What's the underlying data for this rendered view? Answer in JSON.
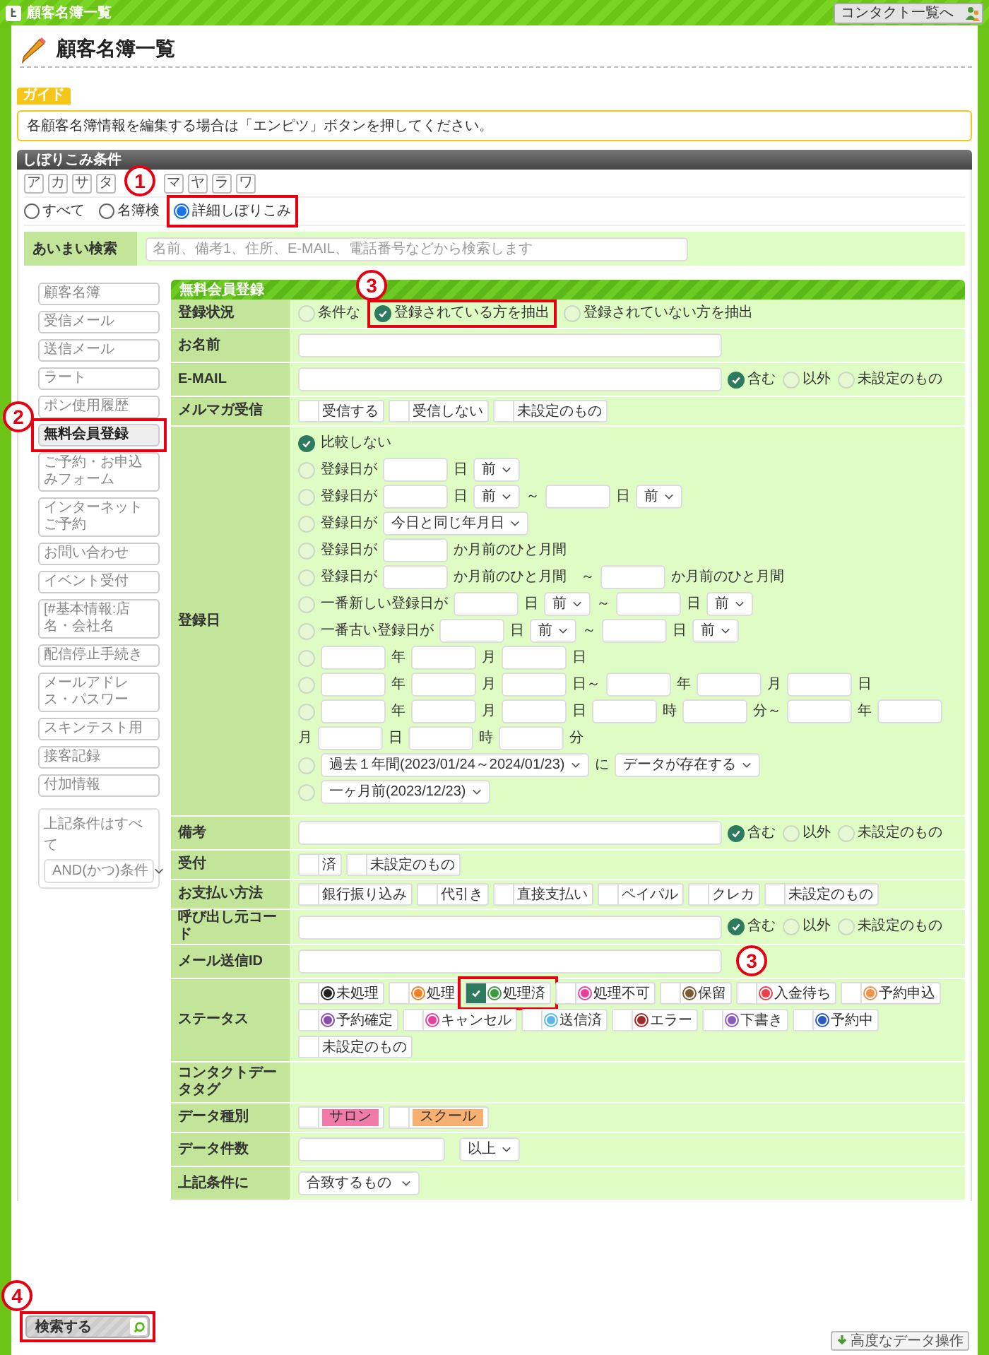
{
  "window": {
    "title": "顧客名簿一覧",
    "nav_button": "コンタクト一覧へ"
  },
  "heading": "顧客名簿一覧",
  "guide": {
    "tag": "ガイド",
    "text": "各顧客名簿情報を編集する場合は「エンピツ」ボタンを押してください。"
  },
  "filter_panel": {
    "title": "しぼりこみ条件",
    "kana": [
      "ア",
      "カ",
      "サ",
      "タ",
      "マ",
      "ヤ",
      "ラ",
      "ワ"
    ],
    "modes": [
      {
        "label": "すべて",
        "selected": false
      },
      {
        "label": "名簿検",
        "selected": false
      },
      {
        "label": "詳細しぼりこみ",
        "selected": true
      }
    ],
    "fuzzy_search": {
      "label": "あいまい検索",
      "placeholder": "名前、備考1、住所、E-MAIL、電話番号などから検索します"
    }
  },
  "sidebar": {
    "items": [
      {
        "label": "顧客名簿",
        "selected": false
      },
      {
        "label": "受信メール",
        "selected": false
      },
      {
        "label": "送信メール",
        "selected": false
      },
      {
        "label": "ラート",
        "selected": false
      },
      {
        "label": "ポン使用履歴",
        "selected": false
      },
      {
        "label": "無料会員登録",
        "selected": true
      },
      {
        "label": "ご予約・お申込みフォーム",
        "selected": false
      },
      {
        "label": "インターネットご予約",
        "selected": false
      },
      {
        "label": "お問い合わせ",
        "selected": false
      },
      {
        "label": "イベント受付",
        "selected": false
      },
      {
        "label": "[#基本情報:店名・会社名",
        "selected": false
      },
      {
        "label": "配信停止手続き",
        "selected": false
      },
      {
        "label": "メールアドレス・パスワー",
        "selected": false
      },
      {
        "label": "スキンテスト用",
        "selected": false
      },
      {
        "label": "接客記録",
        "selected": false
      },
      {
        "label": "付加情報",
        "selected": false
      }
    ],
    "combine": {
      "label": "上記条件はすべて",
      "value": "AND(かつ)条件"
    }
  },
  "form": {
    "title": "無料会員登録",
    "rows": [
      {
        "kind": "radios",
        "label": "登録状況",
        "options": [
          {
            "label": "条件な",
            "selected": false
          },
          {
            "label": "登録されている方を抽出",
            "selected": true
          },
          {
            "label": "登録されていない方を抽出",
            "selected": false
          }
        ]
      },
      {
        "kind": "text",
        "label": "お名前"
      },
      {
        "kind": "text_match",
        "label": "E-MAIL",
        "options": [
          {
            "label": "含む",
            "selected": true
          },
          {
            "label": "以外",
            "selected": false
          },
          {
            "label": "未設定のもの",
            "selected": false
          }
        ]
      },
      {
        "kind": "checks",
        "label": "メルマガ受信",
        "options": [
          {
            "label": "受信する",
            "checked": false
          },
          {
            "label": "受信しない",
            "checked": false
          },
          {
            "label": "未設定のもの",
            "checked": false
          }
        ]
      },
      {
        "kind": "dates",
        "label": "登録日",
        "lines": [
          {
            "selected": true,
            "parts": [
              {
                "kind": "text",
                "text": "比較しない"
              }
            ]
          },
          {
            "selected": false,
            "parts": [
              {
                "kind": "text",
                "text": "登録日が"
              },
              {
                "kind": "input"
              },
              {
                "kind": "text",
                "text": "日"
              },
              {
                "kind": "select",
                "value": "前"
              }
            ]
          },
          {
            "selected": false,
            "parts": [
              {
                "kind": "text",
                "text": "登録日が"
              },
              {
                "kind": "input"
              },
              {
                "kind": "text",
                "text": "日"
              },
              {
                "kind": "select",
                "value": "前"
              },
              {
                "kind": "text",
                "text": "～"
              },
              {
                "kind": "input"
              },
              {
                "kind": "text",
                "text": "日"
              },
              {
                "kind": "select",
                "value": "前"
              }
            ]
          },
          {
            "selected": false,
            "parts": [
              {
                "kind": "text",
                "text": "登録日が"
              },
              {
                "kind": "select",
                "value": "今日と同じ年月日"
              }
            ]
          },
          {
            "selected": false,
            "parts": [
              {
                "kind": "text",
                "text": "登録日が"
              },
              {
                "kind": "input"
              },
              {
                "kind": "text",
                "text": "か月前のひと月間"
              }
            ]
          },
          {
            "selected": false,
            "parts": [
              {
                "kind": "text",
                "text": "登録日が"
              },
              {
                "kind": "input"
              },
              {
                "kind": "text",
                "text": "か月前のひと月間　～"
              },
              {
                "kind": "input"
              },
              {
                "kind": "text",
                "text": "か月前のひと月間"
              }
            ]
          },
          {
            "selected": false,
            "parts": [
              {
                "kind": "text",
                "text": "一番新しい登録日が"
              },
              {
                "kind": "input"
              },
              {
                "kind": "text",
                "text": "日"
              },
              {
                "kind": "select",
                "value": "前"
              },
              {
                "kind": "text",
                "text": "～"
              },
              {
                "kind": "input"
              },
              {
                "kind": "text",
                "text": "日"
              },
              {
                "kind": "select",
                "value": "前"
              }
            ]
          },
          {
            "selected": false,
            "parts": [
              {
                "kind": "text",
                "text": "一番古い登録日が"
              },
              {
                "kind": "input"
              },
              {
                "kind": "text",
                "text": "日"
              },
              {
                "kind": "select",
                "value": "前"
              },
              {
                "kind": "text",
                "text": "～"
              },
              {
                "kind": "input"
              },
              {
                "kind": "text",
                "text": "日"
              },
              {
                "kind": "select",
                "value": "前"
              }
            ]
          },
          {
            "selected": false,
            "parts": [
              {
                "kind": "input"
              },
              {
                "kind": "text",
                "text": "年"
              },
              {
                "kind": "input"
              },
              {
                "kind": "text",
                "text": "月"
              },
              {
                "kind": "input"
              },
              {
                "kind": "text",
                "text": "日"
              }
            ]
          },
          {
            "selected": false,
            "parts": [
              {
                "kind": "input"
              },
              {
                "kind": "text",
                "text": "年"
              },
              {
                "kind": "input"
              },
              {
                "kind": "text",
                "text": "月"
              },
              {
                "kind": "input"
              },
              {
                "kind": "text",
                "text": "日～"
              },
              {
                "kind": "input"
              },
              {
                "kind": "text",
                "text": "年"
              },
              {
                "kind": "input"
              },
              {
                "kind": "text",
                "text": "月"
              },
              {
                "kind": "input"
              },
              {
                "kind": "text",
                "text": "日"
              }
            ]
          },
          {
            "selected": false,
            "parts": [
              {
                "kind": "input"
              },
              {
                "kind": "text",
                "text": "年"
              },
              {
                "kind": "input"
              },
              {
                "kind": "text",
                "text": "月"
              },
              {
                "kind": "input"
              },
              {
                "kind": "text",
                "text": "日"
              },
              {
                "kind": "input"
              },
              {
                "kind": "text",
                "text": "時"
              },
              {
                "kind": "input"
              },
              {
                "kind": "text",
                "text": "分～"
              },
              {
                "kind": "input"
              },
              {
                "kind": "text",
                "text": "年"
              },
              {
                "kind": "input"
              },
              {
                "kind": "text",
                "text": "月"
              },
              {
                "kind": "input"
              },
              {
                "kind": "text",
                "text": "日"
              },
              {
                "kind": "input"
              },
              {
                "kind": "text",
                "text": "時"
              },
              {
                "kind": "input"
              },
              {
                "kind": "text",
                "text": "分"
              }
            ]
          },
          {
            "selected": false,
            "parts": [
              {
                "kind": "select",
                "value": "過去１年間(2023/01/24～2024/01/23)"
              },
              {
                "kind": "text",
                "text": "に"
              },
              {
                "kind": "select",
                "value": "データが存在する"
              }
            ]
          },
          {
            "selected": false,
            "parts": [
              {
                "kind": "select",
                "value": "一ヶ月前(2023/12/23)"
              }
            ]
          }
        ]
      },
      {
        "kind": "text_match",
        "label": "備考",
        "options": [
          {
            "label": "含む",
            "selected": true
          },
          {
            "label": "以外",
            "selected": false
          },
          {
            "label": "未設定のもの",
            "selected": false
          }
        ]
      },
      {
        "kind": "checks",
        "label": "受付",
        "options": [
          {
            "label": "済",
            "checked": false
          },
          {
            "label": "未設定のもの",
            "checked": false
          }
        ]
      },
      {
        "kind": "checks",
        "label": "お支払い方法",
        "options": [
          {
            "label": "銀行振り込み",
            "checked": false
          },
          {
            "label": "代引き",
            "checked": false
          },
          {
            "label": "直接支払い",
            "checked": false
          },
          {
            "label": "ペイパル",
            "checked": false
          },
          {
            "label": "クレカ",
            "checked": false
          },
          {
            "label": "未設定のもの",
            "checked": false
          }
        ]
      },
      {
        "kind": "text_match",
        "label": "呼び出し元コード",
        "options": [
          {
            "label": "含む",
            "selected": true
          },
          {
            "label": "以外",
            "selected": false
          },
          {
            "label": "未設定のもの",
            "selected": false
          }
        ]
      },
      {
        "kind": "text",
        "label": "メール送信ID"
      },
      {
        "kind": "checks",
        "label": "ステータス",
        "options": [
          {
            "label": "未処理",
            "checked": false,
            "color": "#222222"
          },
          {
            "label": "処理",
            "checked": false,
            "color": "#f08020"
          },
          {
            "label": "処理済",
            "checked": true,
            "color": "#3a9a40"
          },
          {
            "label": "処理不可",
            "checked": false,
            "color": "#e83e9c"
          },
          {
            "label": "保留",
            "checked": false,
            "color": "#7a5a30"
          },
          {
            "label": "入金待ち",
            "checked": false,
            "color": "#e8404a"
          },
          {
            "label": "予約申込",
            "checked": false,
            "color": "#f0904a"
          },
          {
            "label": "予約確定",
            "checked": false,
            "color": "#8a4ab0"
          },
          {
            "label": "キャンセル",
            "checked": false,
            "color": "#e83e9c"
          },
          {
            "label": "送信済",
            "checked": false,
            "color": "#5ab8e8"
          },
          {
            "label": "エラー",
            "checked": false,
            "color": "#a02828"
          },
          {
            "label": "下書き",
            "checked": false,
            "color": "#8a5ac0"
          },
          {
            "label": "予約中",
            "checked": false,
            "color": "#2a5ac0"
          },
          {
            "label": "未設定のもの",
            "checked": false
          }
        ]
      },
      {
        "kind": "empty",
        "label": "コンタクトデータタグ"
      },
      {
        "kind": "checks",
        "label": "データ種別",
        "options": [
          {
            "label": "サロン",
            "checked": false,
            "color": "#f07aa8"
          },
          {
            "label": "スクール",
            "checked": false,
            "color": "#f8b070"
          }
        ]
      },
      {
        "kind": "text_select",
        "label": "データ件数",
        "value": "以上"
      },
      {
        "kind": "select",
        "label": "上記条件に",
        "value": "合致するもの"
      }
    ]
  },
  "search_button": "検索する",
  "advanced_button": "高度なデータ操作",
  "callouts": [
    {
      "number": "1"
    },
    {
      "number": "2"
    },
    {
      "number": "3"
    },
    {
      "number": "3"
    },
    {
      "number": "4"
    }
  ]
}
